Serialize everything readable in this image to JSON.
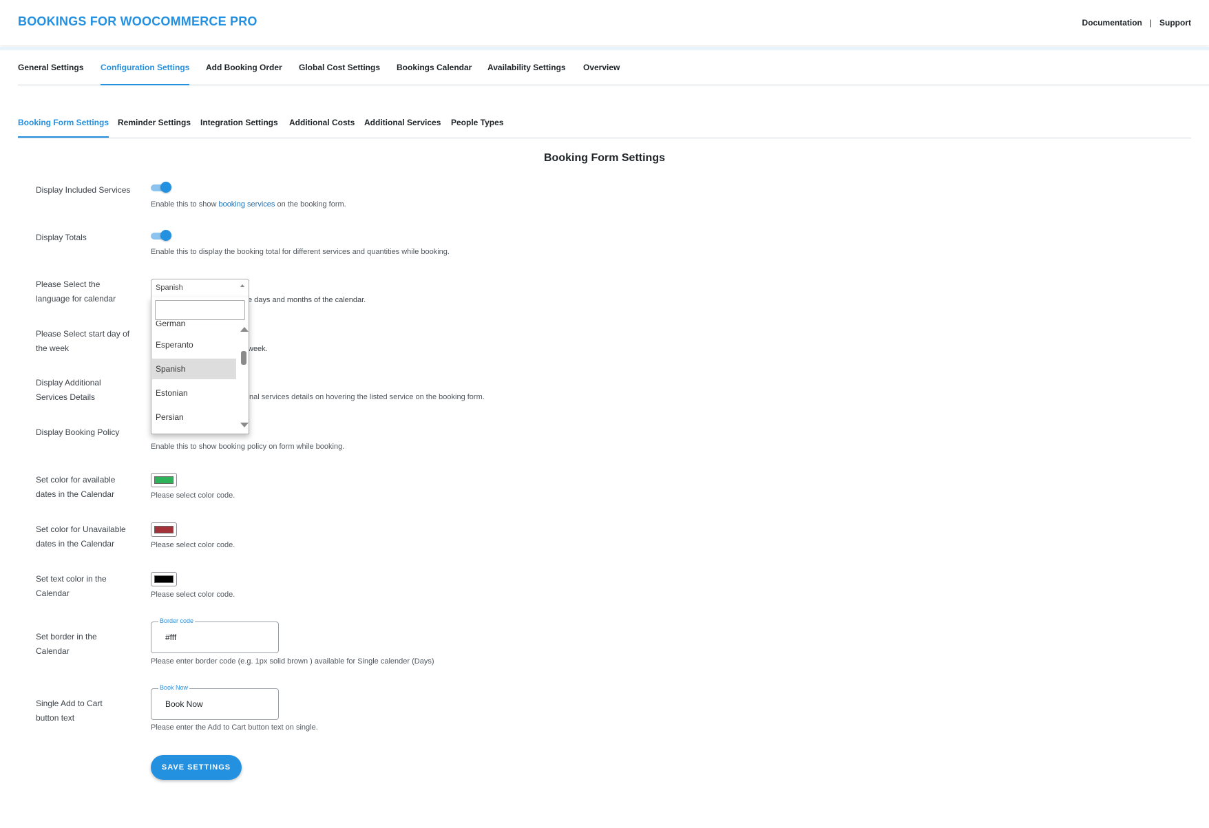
{
  "header": {
    "brand": "BOOKINGS FOR WOOCOMMERCE PRO",
    "links": [
      "Documentation",
      "Support"
    ],
    "separator": "|"
  },
  "main_tabs": [
    {
      "label": "General Settings",
      "active": false
    },
    {
      "label": "Configuration Settings",
      "active": true
    },
    {
      "label": "Add Booking Order",
      "active": false
    },
    {
      "label": "Global Cost Settings",
      "active": false
    },
    {
      "label": "Bookings Calendar",
      "active": false
    },
    {
      "label": "Availability Settings",
      "active": false
    },
    {
      "label": "Overview",
      "active": false
    }
  ],
  "sub_tabs": [
    {
      "label": "Booking Form Settings",
      "active": true
    },
    {
      "label": "Reminder Settings",
      "active": false
    },
    {
      "label": "Integration Settings",
      "active": false
    },
    {
      "label": "Additional Costs",
      "active": false
    },
    {
      "label": "Additional Services",
      "active": false
    },
    {
      "label": "People Types",
      "active": false
    }
  ],
  "section_title": "Booking Form Settings",
  "settings": {
    "included_services": {
      "label": "Display Included Services",
      "desc_before": "Enable this to show ",
      "desc_link": "booking services",
      "desc_after": " on the booking form.",
      "enabled": true
    },
    "totals": {
      "label": "Display Totals",
      "desc": "Enable this to display the booking total for different services and quantities while booking.",
      "enabled": true
    },
    "language": {
      "label": "Please Select the language for calendar",
      "selected": "Spanish",
      "desc_visible": "e days and months of the calendar.",
      "options": [
        "German",
        "Esperanto",
        "Spanish",
        "Estonian",
        "Persian"
      ],
      "highlighted": "Spanish"
    },
    "start_day": {
      "label": "Please Select start day of the week",
      "desc_visible": "week."
    },
    "additional_services_details": {
      "label": "Display Additional Services Details",
      "desc_visible": "nal services details on hovering the listed service on the booking form."
    },
    "booking_policy": {
      "label": "Display Booking Policy",
      "desc": "Enable this to show booking policy on form while booking."
    },
    "available_color": {
      "label": "Set color for available dates in the Calendar",
      "color": "#2fb35a",
      "desc": "Please select color code."
    },
    "unavailable_color": {
      "label": "Set color for Unavailable dates in the Calendar",
      "color": "#a3323a",
      "desc": "Please select color code."
    },
    "text_color": {
      "label": "Set text color in the Calendar",
      "color": "#000000",
      "desc": "Please select color code."
    },
    "border": {
      "label": "Set border in the Calendar",
      "legend": "Border code",
      "value": "#fff",
      "desc": "Please enter border code (e.g. 1px solid brown ) available for Single calender (Days)"
    },
    "add_to_cart": {
      "label": "Single Add to Cart button text",
      "legend": "Book Now",
      "value": "Book Now",
      "desc": "Please enter the Add to Cart button text on single."
    }
  },
  "save_button": "SAVE SETTINGS",
  "colors": {
    "accent": "#2490e0",
    "toggle_track": "#8cc3ef"
  }
}
